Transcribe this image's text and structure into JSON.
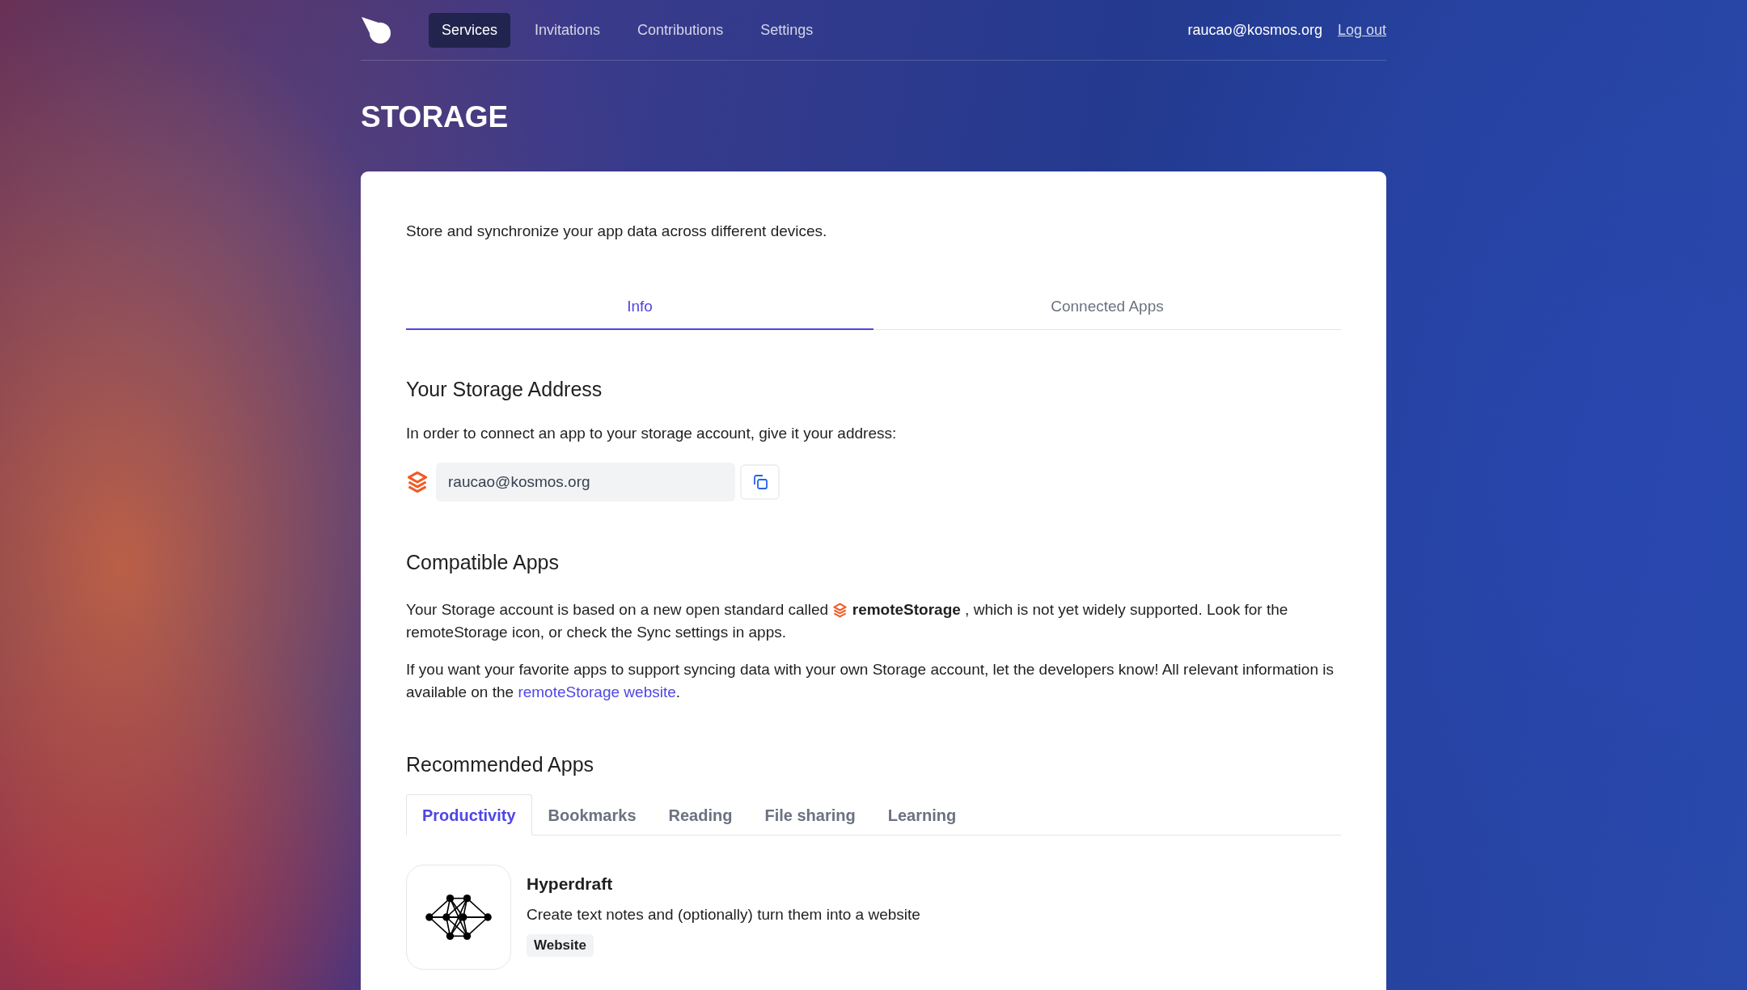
{
  "nav": {
    "items": [
      {
        "label": "Services",
        "selected": true
      },
      {
        "label": "Invitations",
        "selected": false
      },
      {
        "label": "Contributions",
        "selected": false
      },
      {
        "label": "Settings",
        "selected": false
      }
    ],
    "user": "raucao@kosmos.org",
    "logout": "Log out"
  },
  "page_title": "STORAGE",
  "description": "Store and synchronize your app data across different devices.",
  "tabs": [
    {
      "label": "Info",
      "selected": true
    },
    {
      "label": "Connected Apps",
      "selected": false
    }
  ],
  "storage_address": {
    "heading": "Your Storage Address",
    "instruction": "In order to connect an app to your storage account, give it your address:",
    "address": "raucao@kosmos.org"
  },
  "compatible_apps": {
    "heading": "Compatible Apps",
    "paragraph_1": {
      "before": "Your Storage account is based on a new open standard called ",
      "name": "remoteStorage",
      "after": " , which is not yet widely supported. Look for the remoteStorage icon, or check the Sync settings in apps."
    },
    "paragraph_2": {
      "before": "If you want your favorite apps to support syncing data with your own Storage account, let the developers know! All relevant information is available on the ",
      "link": "remoteStorage website",
      "after": "."
    }
  },
  "recommended_apps": {
    "heading": "Recommended Apps",
    "categories": [
      {
        "label": "Productivity",
        "selected": true
      },
      {
        "label": "Bookmarks",
        "selected": false
      },
      {
        "label": "Reading",
        "selected": false
      },
      {
        "label": "File sharing",
        "selected": false
      },
      {
        "label": "Learning",
        "selected": false
      }
    ],
    "apps": [
      {
        "name": "Hyperdraft",
        "description": "Create text notes and (optionally) turn them into a website",
        "tags": [
          "Website"
        ]
      }
    ]
  }
}
